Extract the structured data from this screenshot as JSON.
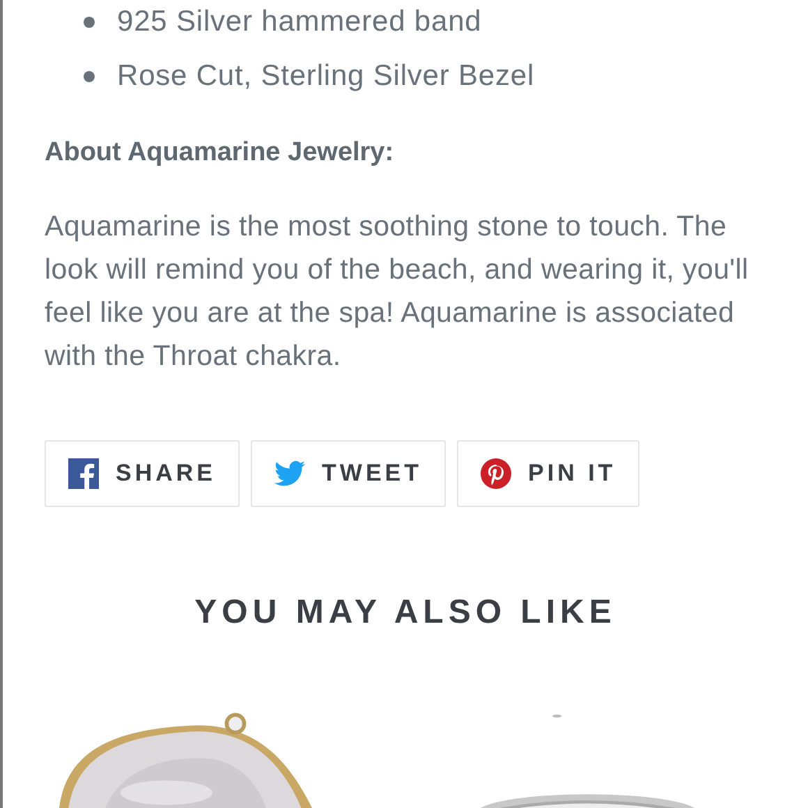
{
  "features": [
    "925 Silver hammered band",
    "Rose Cut, Sterling Silver Bezel"
  ],
  "about": {
    "heading": "About Aquamarine Jewelry:",
    "text": "Aquamarine is the most soothing stone to touch. The look will remind you of the beach, and wearing it, you'll feel like you are at the spa! Aquamarine is associated with the Throat chakra."
  },
  "share_buttons": [
    {
      "kind": "facebook",
      "label": "SHARE"
    },
    {
      "kind": "twitter",
      "label": "TWEET"
    },
    {
      "kind": "pinterest",
      "label": "PIN IT"
    }
  ],
  "related": {
    "heading": "YOU MAY ALSO LIKE"
  }
}
